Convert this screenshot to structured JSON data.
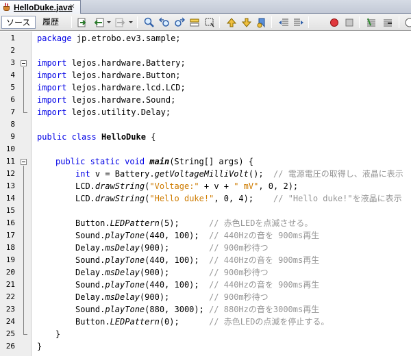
{
  "tab": {
    "title": "HelloDuke.java",
    "close": "×"
  },
  "toolbar": {
    "source_label": "ソース",
    "history_label": "履歴"
  },
  "code": {
    "line_numbers": [
      "1",
      "2",
      "3",
      "4",
      "5",
      "6",
      "7",
      "8",
      "9",
      "10",
      "11",
      "12",
      "13",
      "14",
      "15",
      "16",
      "17",
      "18",
      "19",
      "20",
      "21",
      "22",
      "23",
      "24",
      "25",
      "26"
    ],
    "l1": {
      "kw": "package",
      "rest": " jp.etrobo.ev3.sample;"
    },
    "l3": {
      "kw": "import",
      "rest": " lejos.hardware.Battery;"
    },
    "l4": {
      "kw": "import",
      "rest": " lejos.hardware.Button;"
    },
    "l5": {
      "kw": "import",
      "rest": " lejos.hardware.lcd.LCD;"
    },
    "l6": {
      "kw": "import",
      "rest": " lejos.hardware.Sound;"
    },
    "l7": {
      "kw": "import",
      "rest": " lejos.utility.Delay;"
    },
    "l9": {
      "kw": "public class",
      "cls": "HelloDuke",
      "rest": " {"
    },
    "l11": {
      "kw": "public static void",
      "method": "main",
      "rest": "(String[] args) {"
    },
    "l12": {
      "kw": "int",
      "a": " v = Battery.",
      "call": "getVoltageMilliVolt",
      "b": "();  ",
      "cmt": "// 電源電圧の取得し、液晶に表示"
    },
    "l13": {
      "a": "LCD.",
      "call": "drawString",
      "b": "(",
      "s1": "\"Voltage:\"",
      "c": " + v + ",
      "s2": "\" mV\"",
      "d": ", 0, 2);"
    },
    "l14": {
      "a": "LCD.",
      "call": "drawString",
      "b": "(",
      "s1": "\"Hello duke!\"",
      "d": ", 0, 4);    ",
      "cmt": "// \"Hello duke!\"を液晶に表示"
    },
    "l16": {
      "a": "Button.",
      "call": "LEDPattern",
      "b": "(5);      ",
      "cmt": "// 赤色LEDを点滅させる。"
    },
    "l17": {
      "a": "Sound.",
      "call": "playTone",
      "b": "(440, 100);  ",
      "cmt": "// 440Hzの音を 900ms再生"
    },
    "l18": {
      "a": "Delay.",
      "call": "msDelay",
      "b": "(900);        ",
      "cmt": "// 900m秒待つ"
    },
    "l19": {
      "a": "Sound.",
      "call": "playTone",
      "b": "(440, 100);  ",
      "cmt": "// 440Hzの音を 900ms再生"
    },
    "l20": {
      "a": "Delay.",
      "call": "msDelay",
      "b": "(900);        ",
      "cmt": "// 900m秒待つ"
    },
    "l21": {
      "a": "Sound.",
      "call": "playTone",
      "b": "(440, 100);  ",
      "cmt": "// 440Hzの音を 900ms再生"
    },
    "l22": {
      "a": "Delay.",
      "call": "msDelay",
      "b": "(900);        ",
      "cmt": "// 900m秒待つ"
    },
    "l23": {
      "a": "Sound.",
      "call": "playTone",
      "b": "(880, 3000); ",
      "cmt": "// 880Hzの音を3000ms再生"
    },
    "l24": {
      "a": "Button.",
      "call": "LEDPattern",
      "b": "(0);      ",
      "cmt": "// 赤色LEDの点滅を停止する。"
    },
    "l25": {
      "rest": "}"
    },
    "l26": {
      "rest": "}"
    }
  }
}
